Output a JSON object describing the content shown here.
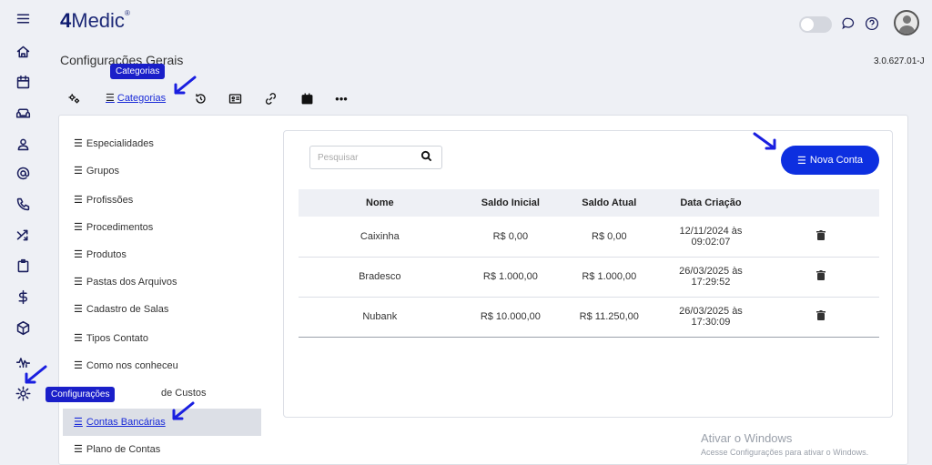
{
  "app": {
    "logo_main": "4",
    "logo_rest": "Medic",
    "logo_mark": "®"
  },
  "header": {
    "title": "Configurações Gerais",
    "version": "3.0.627.01-J"
  },
  "tooltips": {
    "categorias": "Categorias",
    "configuracoes": "Configurações"
  },
  "rail": [
    {
      "name": "menu-icon"
    },
    {
      "name": "home-icon"
    },
    {
      "name": "calendar-icon"
    },
    {
      "name": "sofa-icon"
    },
    {
      "name": "user-icon"
    },
    {
      "name": "at-icon"
    },
    {
      "name": "phone-icon"
    },
    {
      "name": "shuffle-icon"
    },
    {
      "name": "clipboard-icon"
    },
    {
      "name": "dollar-icon"
    },
    {
      "name": "box-icon"
    },
    {
      "name": "chart-icon"
    },
    {
      "name": "gear-icon"
    }
  ],
  "tabs": {
    "active_label": "Categorias"
  },
  "sidebar": {
    "items": [
      "Especialidades",
      "Grupos",
      "Profissões",
      "Procedimentos",
      "Produtos",
      "Pastas dos Arquivos",
      "Cadastro de Salas",
      "Tipos Contato",
      "Como nos conheceu",
      "Centro de Custos",
      "Contas Bancárias",
      "Plano de Contas"
    ],
    "partial_label": "de Custos",
    "active": "Contas Bancárias"
  },
  "search": {
    "placeholder": "Pesquisar"
  },
  "new_button": {
    "label": "Nova Conta"
  },
  "table": {
    "headers": [
      "Nome",
      "Saldo Inicial",
      "Saldo Atual",
      "Data Criação"
    ],
    "rows": [
      {
        "nome": "Caixinha",
        "saldo_inicial": "R$ 0,00",
        "saldo_atual": "R$ 0,00",
        "data_1": "12/11/2024 às",
        "data_2": "09:02:07"
      },
      {
        "nome": "Bradesco",
        "saldo_inicial": "R$ 1.000,00",
        "saldo_atual": "R$ 1.000,00",
        "data_1": "26/03/2025 às",
        "data_2": "17:29:52"
      },
      {
        "nome": "Nubank",
        "saldo_inicial": "R$ 10.000,00",
        "saldo_atual": "R$ 11.250,00",
        "data_1": "26/03/2025 às",
        "data_2": "17:30:09"
      }
    ]
  },
  "watermark": {
    "line1": "Ativar o Windows",
    "line2": "Acesse Configurações para ativar o Windows."
  },
  "colors": {
    "accent": "#0d2fe0",
    "tooltip": "#1a1fc9",
    "background": "#eef0f5"
  }
}
